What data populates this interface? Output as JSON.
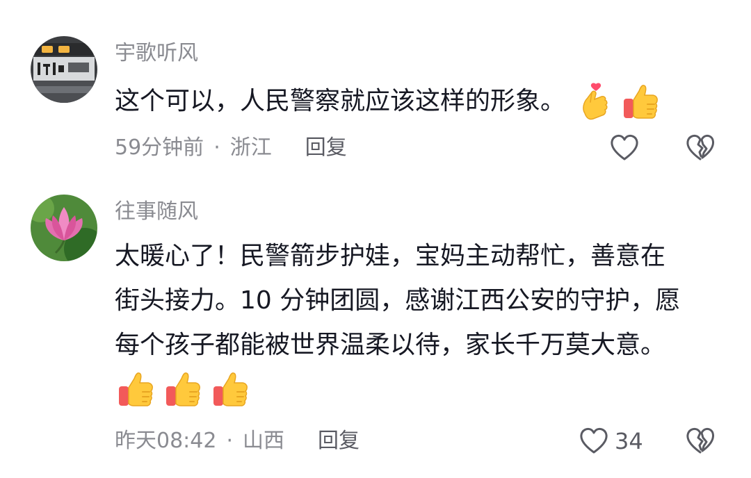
{
  "colors": {
    "text_primary": "#161823",
    "text_secondary": "#8a8b91",
    "icon": "#5a5b63"
  },
  "comments": [
    {
      "username": "宇歌听风",
      "text_lines": [
        "这个可以，人民警察就应该这样的形象。"
      ],
      "emojis": [
        "finger-heart-emoji",
        "thumbs-up-emoji"
      ],
      "time": "59分钟前",
      "dot": "·",
      "location": "浙江",
      "reply_label": "回复",
      "like_count": ""
    },
    {
      "username": "往事随风",
      "text_lines": [
        "太暖心了！民警箭步护娃，宝妈主动帮忙，善意在",
        "街头接力。10 分钟团圆，感谢江西公安的守护，愿",
        "每个孩子都能被世界温柔以待，家长千万莫大意。"
      ],
      "emojis": [
        "thumbs-up-emoji",
        "thumbs-up-emoji",
        "thumbs-up-emoji"
      ],
      "time": "昨天08:42",
      "dot": "·",
      "location": "山西",
      "reply_label": "回复",
      "like_count": "34"
    }
  ]
}
